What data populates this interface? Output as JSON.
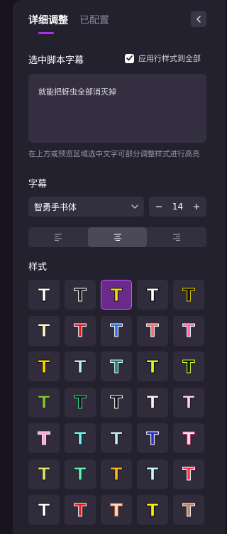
{
  "tabs": [
    {
      "label": "详细调整",
      "active": true
    },
    {
      "label": "已配置",
      "active": false
    }
  ],
  "collapse_icon": "chevron-left-icon",
  "selected_text_section": {
    "title": "选中脚本字幕",
    "apply_checkbox_label": "应用行样式到全部",
    "apply_checked": true,
    "text_value": "就能把蚜虫全部消灭掉",
    "hint": "在上方或预览区域选中文字可部分调整样式进行高亮"
  },
  "subtitle_section": {
    "title": "字幕",
    "font_value": "智勇手书体",
    "font_size": "14",
    "decrement_label": "−",
    "increment_label": "+",
    "alignments": [
      "align-left",
      "align-center",
      "align-right"
    ],
    "selected_alignment": "align-center"
  },
  "style_section": {
    "title": "样式",
    "glyph": "T",
    "presets": [
      {
        "fill": "#ffffff",
        "stroke": "#000000"
      },
      {
        "fill": "#1a1a1a",
        "stroke": "#ffffff"
      },
      {
        "fill": "#ffd200",
        "stroke": "#1a1a1a",
        "selected": true
      },
      {
        "fill": "#ffffff",
        "stroke": "#000000"
      },
      {
        "fill": "#111111",
        "stroke": "#e0c200"
      },
      {
        "fill": "#fff6c8",
        "stroke": "#1a1a1a"
      },
      {
        "fill": "#e01b1b",
        "stroke": "#ffffff"
      },
      {
        "fill": "#2a6ef0",
        "stroke": "#ffffff"
      },
      {
        "fill": "#f26a6a",
        "stroke": "#ffffff"
      },
      {
        "fill": "#ff5fb4",
        "stroke": "#ffffff"
      },
      {
        "fill": "#ffd200",
        "stroke": "#111111"
      },
      {
        "fill": "#bfe8ff",
        "stroke": "#1a1a1a"
      },
      {
        "fill": "#2f7a70",
        "stroke": "#c8fff0"
      },
      {
        "fill": "#c8ff2a",
        "stroke": "#111111"
      },
      {
        "fill": "#111111",
        "stroke": "#c8ff2a"
      },
      {
        "fill": "#8bc23a",
        "stroke": "#1a1a1a"
      },
      {
        "fill": "#111111",
        "stroke": "#2ee890"
      },
      {
        "fill": "#111111",
        "stroke": "#ffffff"
      },
      {
        "fill": "#ffeef8",
        "stroke": "#1a1a1a"
      },
      {
        "fill": "#ffd0f8",
        "stroke": "#1a1a1a"
      },
      {
        "fill": "#ff9fd0",
        "stroke": "#ffffff"
      },
      {
        "fill": "#6ff0f0",
        "stroke": "#1a1a1a"
      },
      {
        "fill": "#bde6ff",
        "stroke": "#1a1a1a"
      },
      {
        "fill": "#1f2fd8",
        "stroke": "#ffffff"
      },
      {
        "fill": "#ffe6f0",
        "stroke": "#c03a6a"
      },
      {
        "fill": "#d8e86a",
        "stroke": "#1a1a1a"
      },
      {
        "fill": "#5af0b0",
        "stroke": "#1a1a1a"
      },
      {
        "fill": "#ffb21e",
        "stroke": "#1a1a1a"
      },
      {
        "fill": "#c8f4ff",
        "stroke": "#1a1a1a"
      },
      {
        "fill": "#ff3050",
        "stroke": "#ffffff"
      },
      {
        "fill": "#ffffff",
        "stroke": "#000000"
      },
      {
        "fill": "#e01b1b",
        "stroke": "#ffffff"
      },
      {
        "fill": "#ffd8c4",
        "stroke": "#c06a40"
      },
      {
        "fill": "#ffee00",
        "stroke": "#111111"
      },
      {
        "fill": "#c87a5a",
        "stroke": "#ffffff"
      }
    ]
  }
}
